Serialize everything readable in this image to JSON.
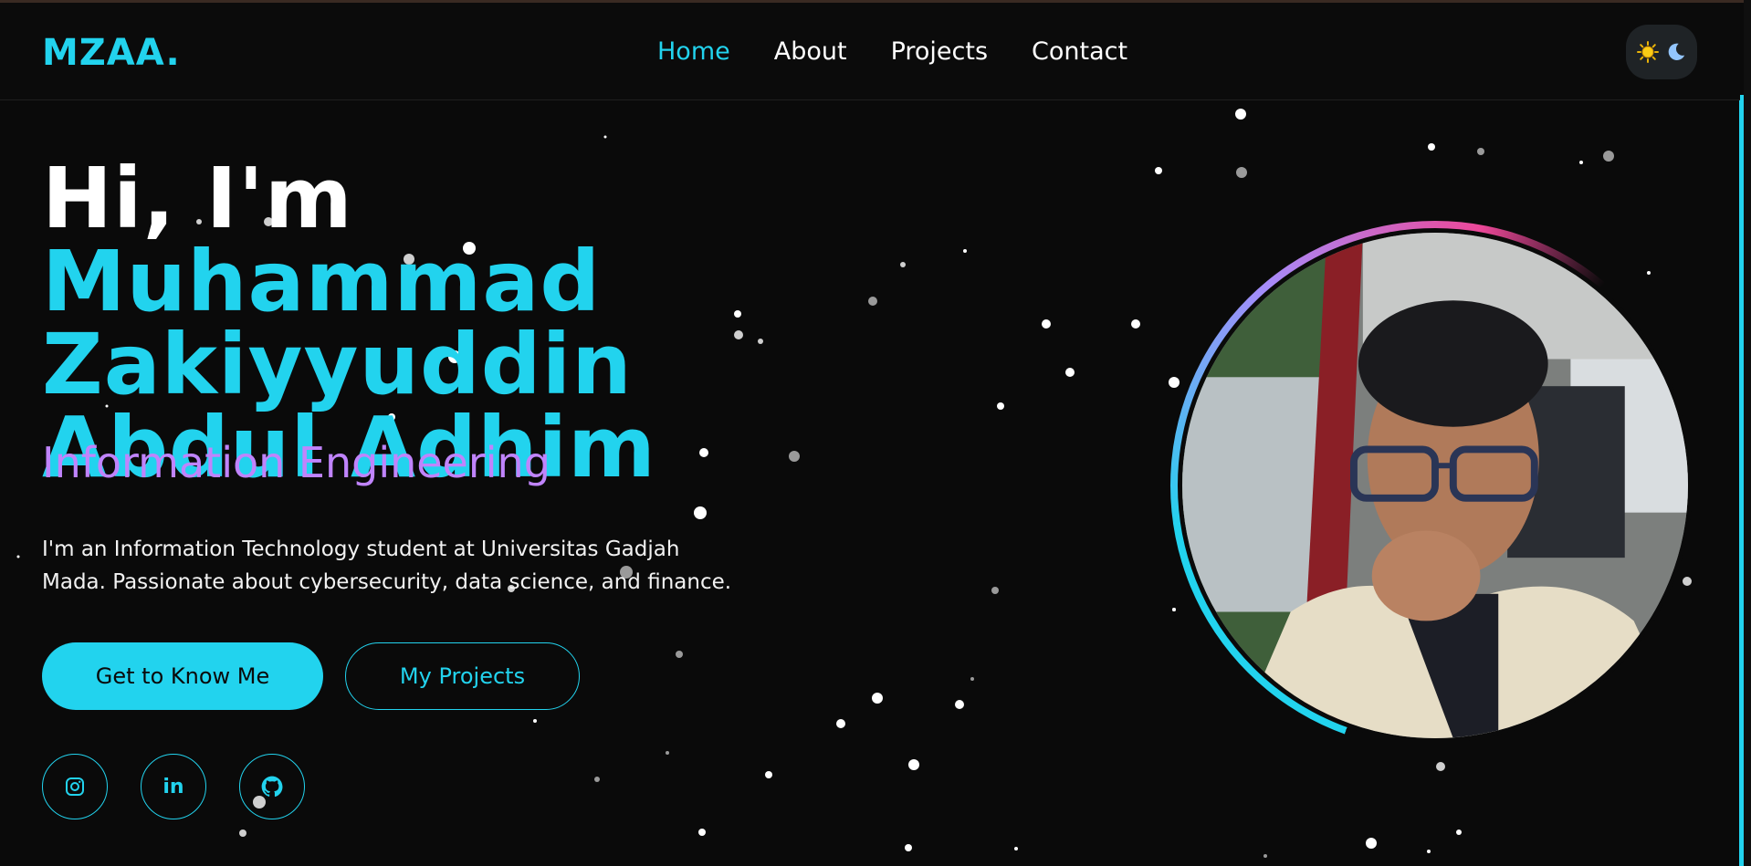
{
  "header": {
    "logo": "MZAA.",
    "nav": [
      {
        "label": "Home",
        "active": true
      },
      {
        "label": "About",
        "active": false
      },
      {
        "label": "Projects",
        "active": false
      },
      {
        "label": "Contact",
        "active": false
      }
    ],
    "theme_toggle": {
      "icons": [
        "sun-icon",
        "moon-icon"
      ]
    }
  },
  "hero": {
    "greeting": "Hi, I'm",
    "name_line1": "Muhammad",
    "name_line2": "Zakiyyuddin",
    "name_line3": "Abdul Adhim",
    "subtitle": "Information Engineering",
    "description_line1": "I'm an Information Technology student at Universitas Gadjah",
    "description_line2": "Mada. Passionate about cybersecurity, data science, and finance.",
    "primary_button": "Get to Know Me",
    "secondary_button": "My Projects",
    "socials": [
      {
        "icon": "instagram-icon"
      },
      {
        "icon": "linkedin-icon",
        "text": "in"
      },
      {
        "icon": "github-icon"
      }
    ]
  },
  "colors": {
    "accent": "#22d3ee",
    "subtitle": "#c084fc",
    "background": "#0a0a0a",
    "ring_pink": "#ec4899"
  }
}
